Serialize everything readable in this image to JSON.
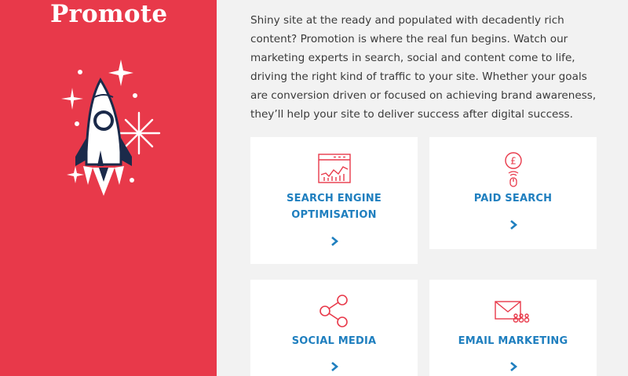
{
  "page": {
    "title": "Promote",
    "intro": "Shiny site at the ready and populated with decadently rich content? Promotion is where the real fun begins. Watch our marketing experts in search, social and content come to life, driving the right kind of traffic to your site. Whether your goals are conversion driven or focused on achieving brand awareness, they’ll help your site to deliver success after digital success."
  },
  "colors": {
    "brand_red": "#e8394a",
    "link_blue": "#1f7fbf",
    "icon_red": "#e8394a",
    "rocket_navy": "#1b2a4a"
  },
  "services": [
    {
      "id": "seo",
      "line1": "SEARCH ENGINE",
      "line2": "OPTIMISATION",
      "icon": "seo-chart-icon"
    },
    {
      "id": "paid",
      "label": "PAID SEARCH",
      "icon": "pound-click-icon",
      "icon_symbol": "£"
    },
    {
      "id": "social",
      "label": "SOCIAL MEDIA",
      "icon": "share-icon"
    },
    {
      "id": "email",
      "label": "EMAIL MARKETING",
      "icon": "envelope-people-icon"
    }
  ]
}
